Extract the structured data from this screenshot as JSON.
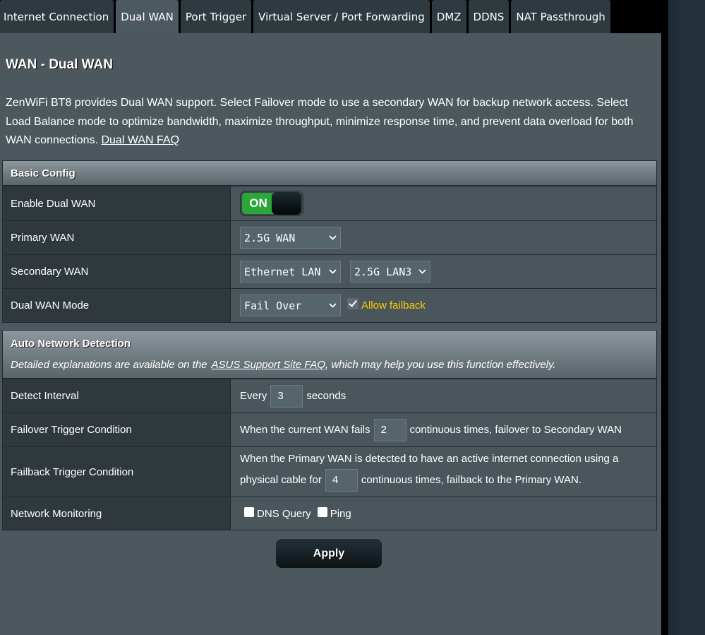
{
  "tabs": [
    {
      "label": "Internet Connection",
      "active": false
    },
    {
      "label": "Dual WAN",
      "active": true
    },
    {
      "label": "Port Trigger",
      "active": false
    },
    {
      "label": "Virtual Server / Port Forwarding",
      "active": false
    },
    {
      "label": "DMZ",
      "active": false
    },
    {
      "label": "DDNS",
      "active": false
    },
    {
      "label": "NAT Passthrough",
      "active": false
    }
  ],
  "page": {
    "title": "WAN - Dual WAN",
    "intro": "ZenWiFi BT8 provides Dual WAN support. Select Failover mode to use a secondary WAN for backup network access. Select Load Balance mode to optimize bandwidth, maximize throughput, minimize response time, and prevent data overload for both WAN connections.",
    "faq_link": "Dual WAN FAQ"
  },
  "basic_config": {
    "title": "Basic Config",
    "enable_dual_wan": {
      "label": "Enable Dual WAN",
      "toggle_text": "ON",
      "value": true
    },
    "primary_wan": {
      "label": "Primary WAN",
      "value": "2.5G WAN"
    },
    "secondary_wan": {
      "label": "Secondary WAN",
      "type_value": "Ethernet LAN",
      "port_value": "2.5G LAN3"
    },
    "dual_wan_mode": {
      "label": "Dual WAN Mode",
      "value": "Fail Over",
      "allow_failback_label": "Allow failback",
      "allow_failback": true
    }
  },
  "auto_detection": {
    "title": "Auto Network Detection",
    "subtitle_pre": "Detailed explanations are available on the",
    "subtitle_link": "ASUS Support Site FAQ",
    "subtitle_post": ", which may help you use this function effectively.",
    "detect_interval": {
      "label": "Detect Interval",
      "pre": "Every",
      "value": "3",
      "post": "seconds"
    },
    "failover_trigger": {
      "label": "Failover Trigger Condition",
      "pre": "When the current WAN fails",
      "value": "2",
      "post": "continuous times, failover to Secondary WAN"
    },
    "failback_trigger": {
      "label": "Failback Trigger Condition",
      "line1": "When the Primary WAN is detected to have an active internet connection using a",
      "pre": "physical cable for",
      "value": "4",
      "post": "continuous times, failback to the Primary WAN."
    },
    "network_monitoring": {
      "label": "Network Monitoring",
      "dns_query_label": "DNS Query",
      "dns_query": false,
      "ping_label": "Ping",
      "ping": false
    }
  },
  "apply_label": "Apply",
  "colors": {
    "toggle_on": "#2ba638",
    "allow_failback": "#ffcc00",
    "panel_bg": "#4d585e"
  }
}
